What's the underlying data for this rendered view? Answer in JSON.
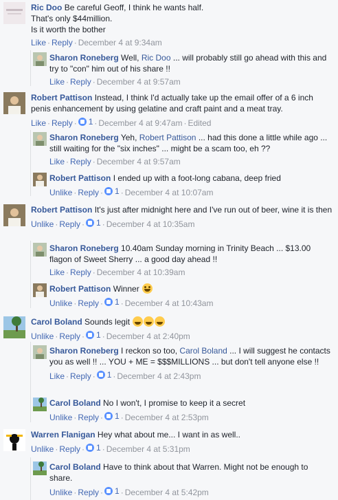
{
  "actions": {
    "like": "Like",
    "unlike": "Unlike",
    "reply": "Reply",
    "edited": "Edited"
  },
  "comments": [
    {
      "author": "Ric Doo",
      "text": "Be careful Geoff, I think he wants half.",
      "text2": "That's only $44million.",
      "text3": "Is it worth the bother",
      "time": "December 4 at 9:34am"
    },
    {
      "author": "Sharon Roneberg",
      "pre": "Well,",
      "mention": "Ric Doo",
      "post": "... will probably still go ahead with this and try to \"con\" him out of his share !!",
      "time": "December 4 at 9:57am"
    },
    {
      "author": "Robert Pattison",
      "text": "Instead, I think I'd actually take up the email offer of a 6 inch penis enhancement by using gelatine and craft paint and a meat tray.",
      "likes": "1",
      "time": "December 4 at 9:47am"
    },
    {
      "author": "Sharon Roneberg",
      "pre": "Yeh,",
      "mention": "Robert Pattison",
      "post": "... had this done a little while ago ... still waiting for the \"six inches\" ... might be a scam too, eh ??",
      "time": "December 4 at 9:57am"
    },
    {
      "author": "Robert Pattison",
      "text": "I ended up with a foot-long cabana, deep fried",
      "likes": "1",
      "time": "December 4 at 10:07am"
    },
    {
      "author": "Robert Pattison",
      "text": "It's just after midnight here and I've run out of beer, wine it is then",
      "likes": "1",
      "time": "December 4 at 10:35am"
    },
    {
      "author": "Sharon Roneberg",
      "text": "10.40am Sunday morning in Trinity Beach ... $13.00 flagon of Sweet Sherry ... a good day ahead !!",
      "time": "December 4 at 10:39am"
    },
    {
      "author": "Robert Pattison",
      "text": "Winner",
      "likes": "1",
      "time": "December 4 at 10:43am"
    },
    {
      "author": "Carol Boland",
      "text": "Sounds legit",
      "likes": "1",
      "time": "December 4 at 2:40pm"
    },
    {
      "author": "Sharon Roneberg",
      "pre": "I reckon so too,",
      "mention": "Carol Boland",
      "post": "... I will suggest he contacts you as well !! ... YOU + ME = $$$MILLIONS ... but don't tell anyone else !!",
      "likes": "1",
      "time": "December 4 at 2:43pm"
    },
    {
      "author": "Carol Boland",
      "text": "No I won't, I promise to keep it a secret",
      "likes": "1",
      "time": "December 4 at 2:53pm"
    },
    {
      "author": "Warren Flanigan",
      "text": "Hey what about me... I want in as well..",
      "likes": "1",
      "time": "December 4 at 5:31pm"
    },
    {
      "author": "Carol Boland",
      "text": "Have to think about that Warren. Might not be enough to share.",
      "likes": "1",
      "time": "December 4 at 5:42pm"
    }
  ],
  "colors": {
    "link": "#365899",
    "action": "#4267b2",
    "meta": "#90949c",
    "background": "#f6f7f9"
  }
}
